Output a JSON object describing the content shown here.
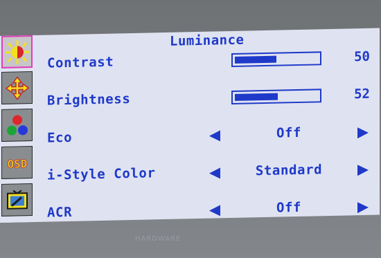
{
  "menu": {
    "title": "Luminance",
    "sidebar": [
      {
        "name": "luminance-icon",
        "active": true
      },
      {
        "name": "position-icon",
        "active": false
      },
      {
        "name": "color-icon",
        "active": false
      },
      {
        "name": "osd-icon",
        "text": "OSD",
        "active": false
      },
      {
        "name": "setup-icon",
        "active": false
      }
    ],
    "contrast": {
      "label": "Contrast",
      "value": "50",
      "level": 0.5
    },
    "brightness": {
      "label": "Brightness",
      "value": "52",
      "level": 0.52
    },
    "eco": {
      "label": "Eco",
      "value": "Off"
    },
    "istyle": {
      "label": "i-Style Color",
      "value": "Standard"
    },
    "acr": {
      "label": "ACR",
      "value": "Off"
    }
  },
  "watermark": "HARDWARE",
  "colors": {
    "text": "#1f39c9",
    "panel": "#dfe3f1",
    "highlight": "#e23dbd"
  }
}
